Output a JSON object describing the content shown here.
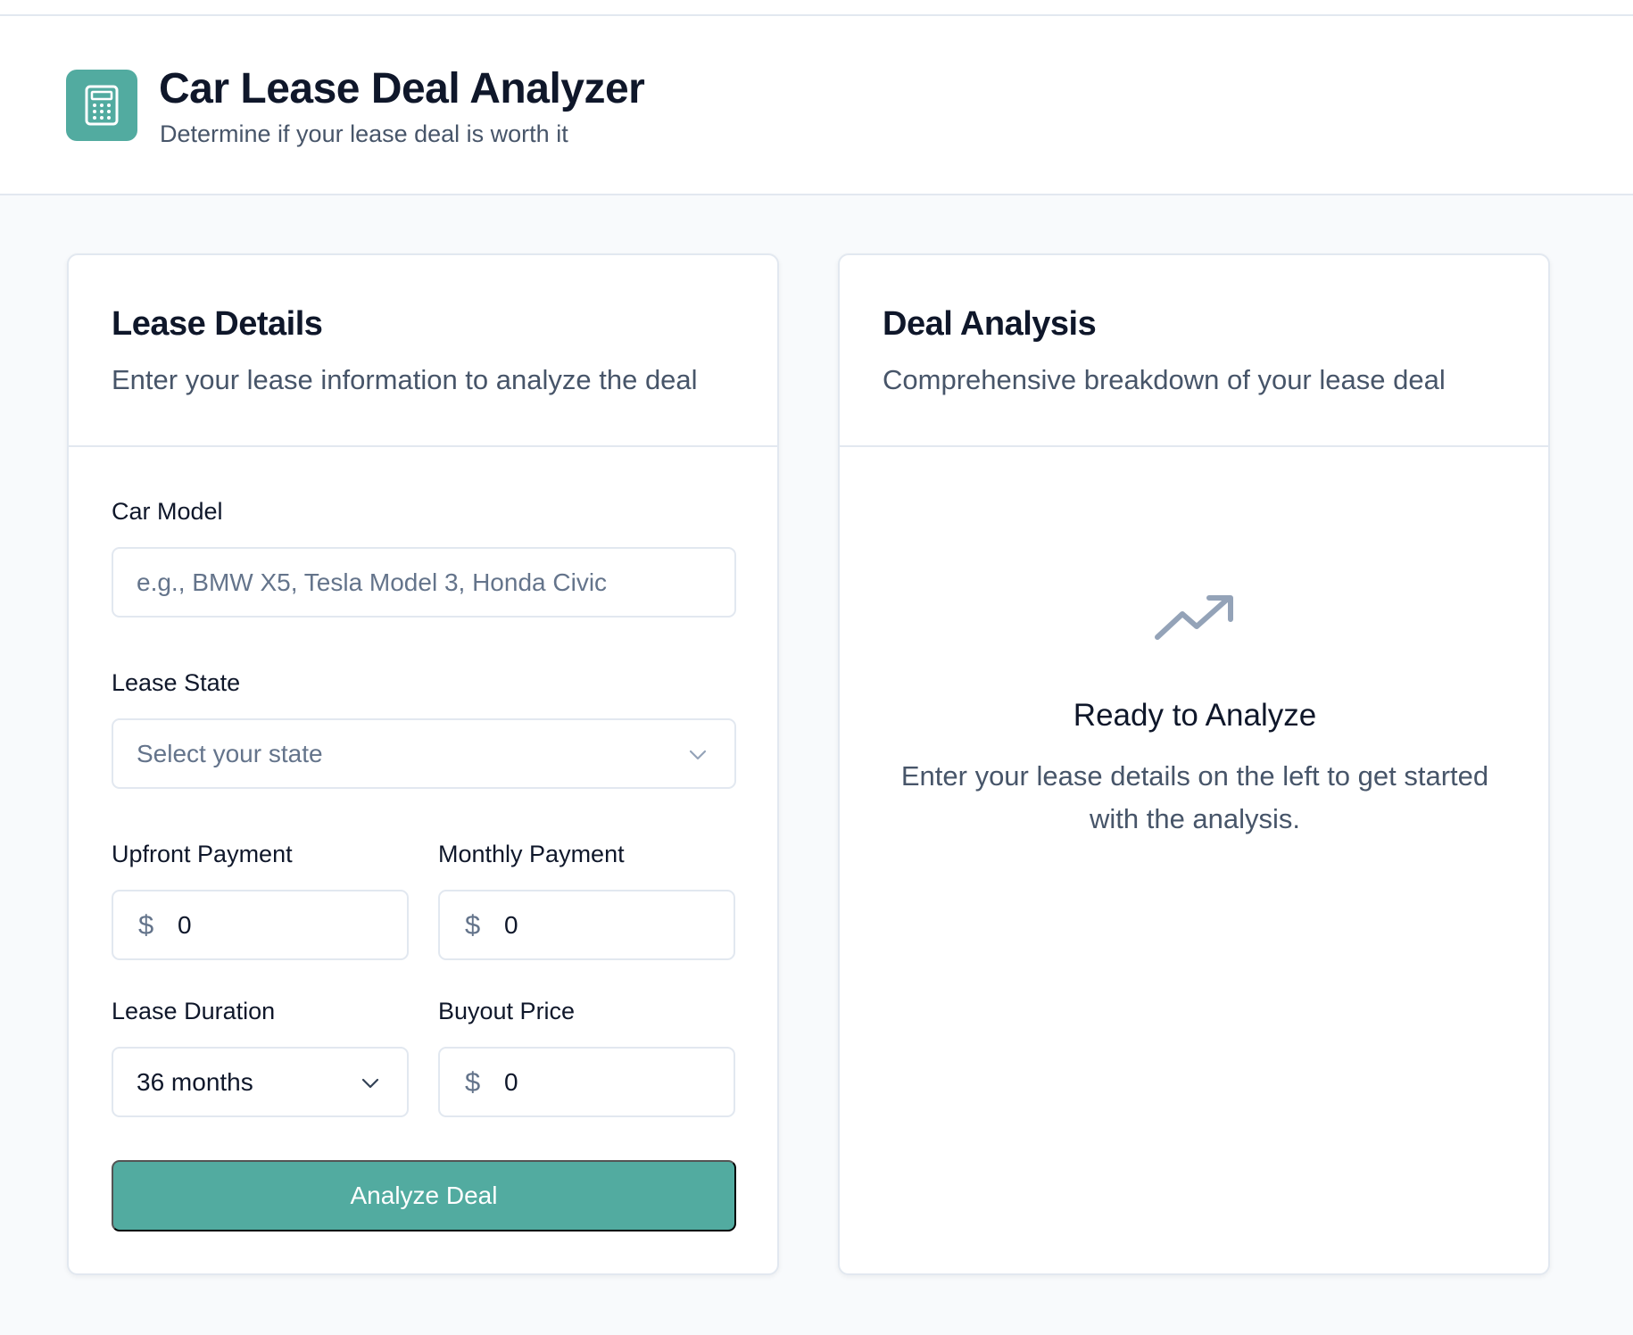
{
  "header": {
    "title": "Car Lease Deal Analyzer",
    "subtitle": "Determine if your lease deal is worth it",
    "logo_icon": "calculator-icon"
  },
  "lease_details": {
    "title": "Lease Details",
    "description": "Enter your lease information to analyze the deal",
    "car_model": {
      "label": "Car Model",
      "placeholder": "e.g., BMW X5, Tesla Model 3, Honda Civic",
      "value": ""
    },
    "lease_state": {
      "label": "Lease State",
      "placeholder": "Select your state"
    },
    "upfront_payment": {
      "label": "Upfront Payment",
      "currency": "$",
      "value": "0"
    },
    "monthly_payment": {
      "label": "Monthly Payment",
      "currency": "$",
      "value": "0"
    },
    "lease_duration": {
      "label": "Lease Duration",
      "value": "36 months"
    },
    "buyout_price": {
      "label": "Buyout Price",
      "currency": "$",
      "value": "0"
    },
    "analyze_button": "Analyze Deal"
  },
  "deal_analysis": {
    "title": "Deal Analysis",
    "description": "Comprehensive breakdown of your lease deal",
    "empty_icon": "trending-up-icon",
    "empty_title": "Ready to Analyze",
    "empty_text": "Enter your lease details on the left to get started with the analysis."
  },
  "colors": {
    "accent": "#52aba0",
    "text": "#0f172a",
    "muted": "#475569",
    "border": "#e2e8f0",
    "background": "#f8fafc"
  }
}
